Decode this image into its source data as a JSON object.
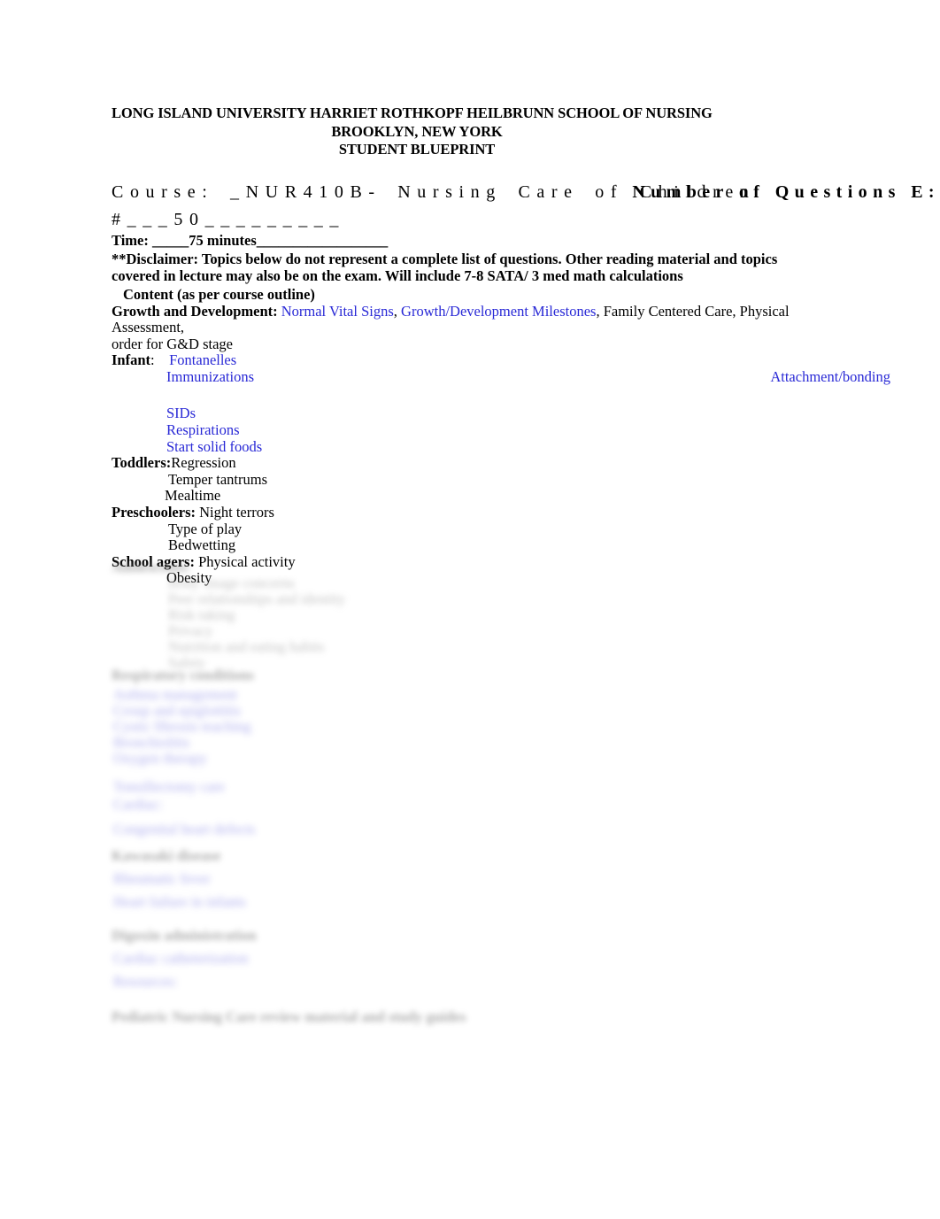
{
  "document": {
    "type": "student-blueprint",
    "link_color": "#2929d6",
    "text_color": "#000000",
    "background": "#ffffff"
  },
  "header": {
    "line1": "LONG ISLAND UNIVERSITY HARRIET ROTHKOPF HEILBRUNN SCHOOL OF NURSING",
    "line2": "BROOKLYN, NEW YORK",
    "line3": "STUDENT BLUEPRINT"
  },
  "course": {
    "label_and_value": "Course:  _NUR410B- Nursing Care of Children",
    "overlay_text": "Number of Questions E:",
    "second_line": "#___50_________",
    "time_line": "Time: _____75 minutes__________________"
  },
  "disclaimer": {
    "text": "**Disclaimer: Topics below do not represent a complete list of questions. Other reading material and topics covered in lecture may also be on the exam. Will include 7-8 SATA/ 3 med math calculations",
    "content_heading": "Content (as per course outline)"
  },
  "outline": {
    "growth_and_development": {
      "label": "Growth and Development:",
      "link_1": "Normal Vital Signs",
      "sep_1": ", ",
      "link_2": "Growth/Development Milestones",
      "rest": ", Family Centered Care, Physical Assessment,",
      "wrap_line": "order for G&D stage"
    },
    "infant": {
      "label": "Infant",
      "colon": ":",
      "items": [
        "Fontanelles",
        "Immunizations",
        "SIDs",
        "Respirations",
        "Start solid foods"
      ],
      "right_item": "Attachment/bonding"
    },
    "toddlers": {
      "label": "Toddlers:",
      "first": "Regression",
      "items": [
        "Temper tantrums",
        "Mealtime"
      ]
    },
    "preschoolers": {
      "label": "Preschoolers:",
      "first": "Night terrors",
      "items": [
        "Type of play",
        "Bedwetting"
      ]
    },
    "school_agers": {
      "label": "School agers:",
      "first": "Physical activity",
      "items": [
        "Obesity"
      ]
    }
  },
  "redacted_section": {
    "note": "lower portion of page is blurred and illegible",
    "placeholder_lines": [
      "Adolescents:",
      "Body image concerns",
      "Peer relationships and identity",
      "Risk taking",
      "Privacy",
      "Nutrition and eating habits",
      "Safety",
      "Respiratory conditions",
      "Asthma management",
      "Croup and epiglottitis",
      "Cystic fibrosis teaching",
      "Bronchiolitis",
      "Oxygen therapy",
      "Tonsillectomy care",
      "Cardiac:",
      "Congenital heart defects",
      "Kawasaki disease",
      "Rheumatic fever",
      "Heart failure in infants",
      "Digoxin administration",
      "Cardiac catheterization",
      "Resources:",
      "Pediatric Nursing Care review material and study guides"
    ]
  }
}
